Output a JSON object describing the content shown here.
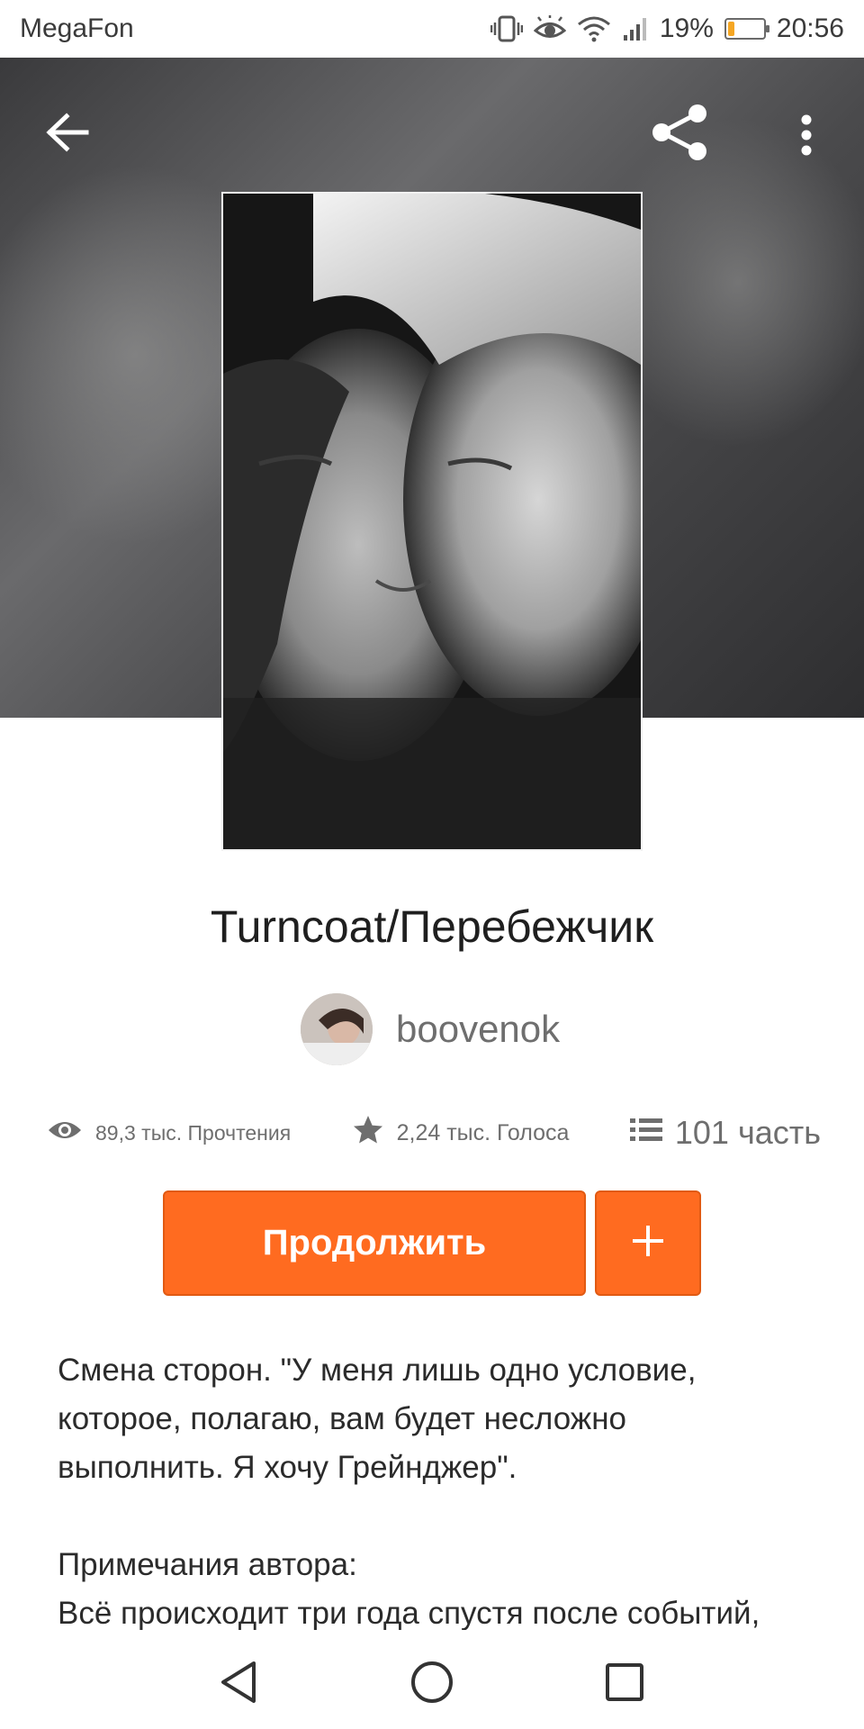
{
  "status_bar": {
    "carrier": "MegaFon",
    "battery_percent": "19%",
    "battery_level": 0.19,
    "time": "20:56",
    "icons": [
      "vibrate-icon",
      "eye-comfort-icon",
      "wifi-icon",
      "signal-icon",
      "battery-icon"
    ]
  },
  "toolbar": {
    "back_icon": "arrow-left-icon",
    "share_icon": "share-icon",
    "more_icon": "more-vertical-icon"
  },
  "story": {
    "title": "Turncoat/Перебежчик",
    "author": "boovenok",
    "reads": "89,3 тыс. Прочтения",
    "votes": "2,24 тыс. Голоса",
    "parts": "101 часть"
  },
  "actions": {
    "continue_label": "Продолжить",
    "add_icon": "plus-icon"
  },
  "description": {
    "line1": "Смена сторон. \"У меня лишь одно условие,",
    "line2": "которое, полагаю, вам будет несложно",
    "line3": "выполнить. Я хочу Грейнджер\".",
    "notes_header": "Примечания автора:",
    "line5": "Всё происходит три года спустя после событий,"
  },
  "colors": {
    "accent": "#ff6b20",
    "accent_border": "#e15a12",
    "text_secondary": "#6e6e6e"
  }
}
